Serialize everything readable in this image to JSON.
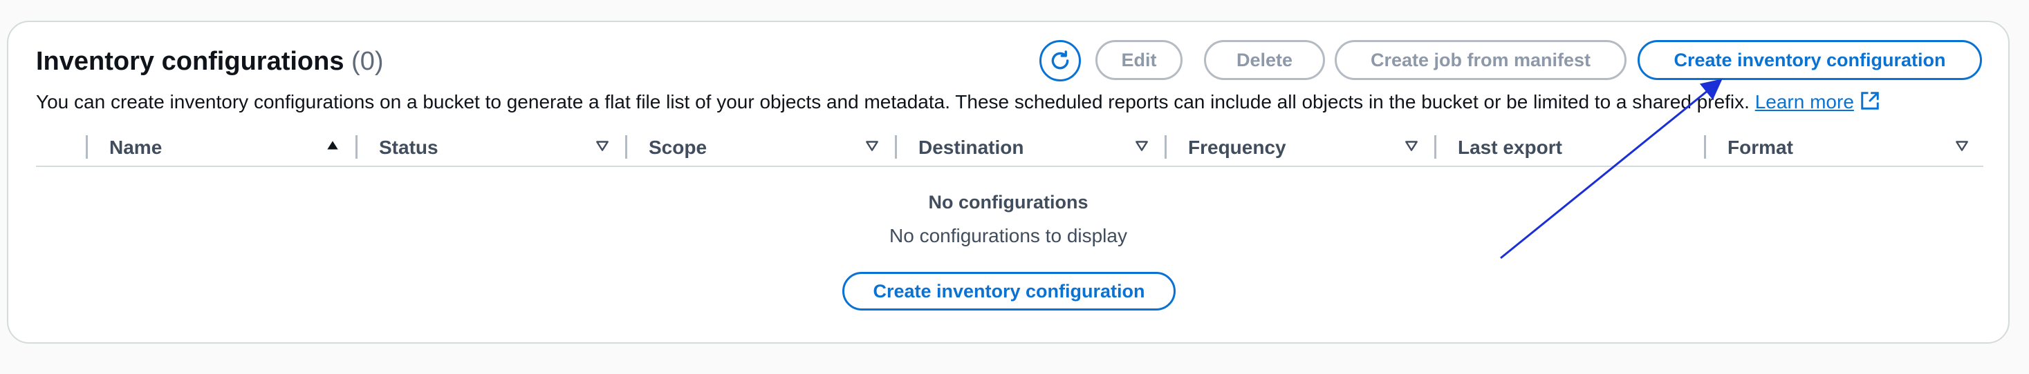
{
  "header": {
    "title": "Inventory configurations",
    "count": "(0)",
    "description": "You can create inventory configurations on a bucket to generate a flat file list of your objects and metadata. These scheduled reports can include all objects in the bucket or be limited to a shared prefix.",
    "learn_more": "Learn more"
  },
  "toolbar": {
    "refresh_icon": "refresh-icon",
    "edit_label": "Edit",
    "delete_label": "Delete",
    "create_job_label": "Create job from manifest",
    "create_config_label": "Create inventory configuration"
  },
  "table": {
    "columns": [
      {
        "label": "Name",
        "sort": "ascending"
      },
      {
        "label": "Status",
        "sort": "sortable"
      },
      {
        "label": "Scope",
        "sort": "sortable"
      },
      {
        "label": "Destination",
        "sort": "sortable"
      },
      {
        "label": "Frequency",
        "sort": "sortable"
      },
      {
        "label": "Last export",
        "sort": "none"
      },
      {
        "label": "Format",
        "sort": "sortable"
      }
    ],
    "empty_title": "No configurations",
    "empty_message": "No configurations to display",
    "empty_button_label": "Create inventory configuration"
  },
  "colors": {
    "accent": "#0972d3",
    "annotation_arrow": "#1a2fd6",
    "disabled": "#8d99a8"
  }
}
